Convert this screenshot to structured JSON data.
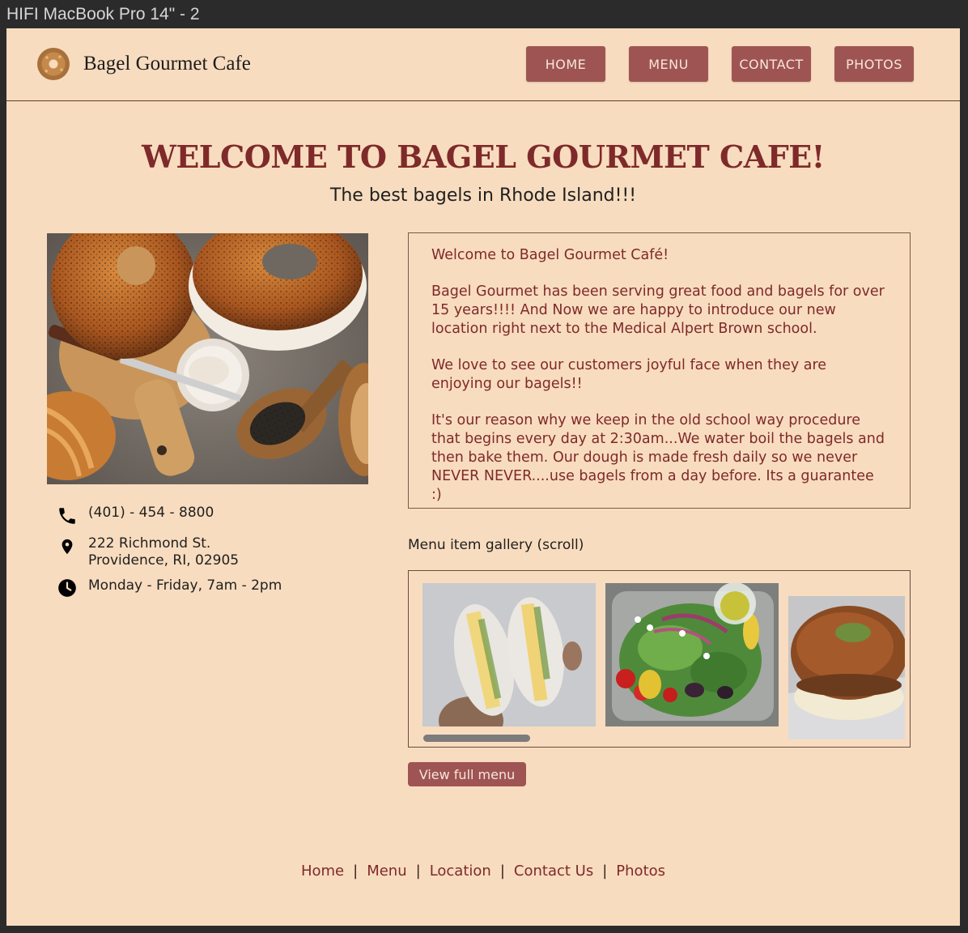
{
  "window": {
    "title": "HIFI MacBook Pro 14\" - 2"
  },
  "header": {
    "site_name": "Bagel Gourmet Cafe",
    "nav": [
      "HOME",
      "MENU",
      "CONTACT",
      "PHOTOS"
    ]
  },
  "hero": {
    "title": "WELCOME TO BAGEL GOURMET CAFE!",
    "subtitle": "The best bagels in Rhode Island!!!"
  },
  "contact": {
    "phone": "(401) - 454 - 8800",
    "address_line1": "222 Richmond St.",
    "address_line2": "Providence, RI, 02905",
    "hours": "Monday - Friday, 7am - 2pm",
    "icons": [
      "phone-icon",
      "location-pin-icon",
      "clock-icon"
    ]
  },
  "about": {
    "paragraphs": [
      "Welcome to Bagel Gourmet Café!",
      "Bagel Gourmet has been serving great food and bagels for over 15 years!!!! And Now we are happy to introduce our new location right next to the Medical Alpert Brown school.",
      "We love to see our customers joyful face when they are enjoying our bagels!!",
      "It's our reason why we keep in the old school way procedure that begins every day at 2:30am...We water boil the bagels and then bake them. Our dough is made fresh daily so we never NEVER NEVER....use bagels from a day before. Its a guarantee :)"
    ]
  },
  "gallery": {
    "label": "Menu item gallery (scroll)"
  },
  "menu_button": "View full menu",
  "footer": {
    "links": [
      "Home",
      "Menu",
      "Location",
      "Contact Us",
      "Photos"
    ],
    "separator": "|"
  },
  "colors": {
    "background": "#f8dcbf",
    "accent": "#9f5454",
    "title": "#7e2a2a"
  }
}
